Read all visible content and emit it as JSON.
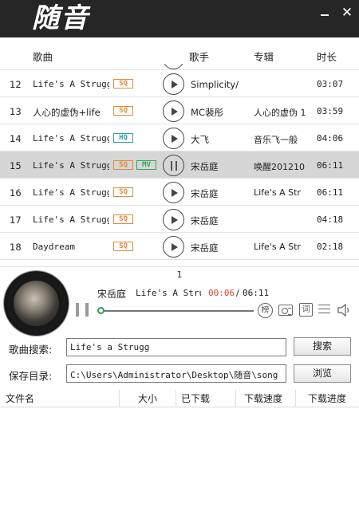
{
  "app": {
    "logo_text": "随音",
    "minimize_label": "",
    "close_label": "✕"
  },
  "song_list": {
    "headers": {
      "song": "歌曲",
      "singer": "歌手",
      "album": "专辑",
      "duration": "时长"
    },
    "rows": [
      {
        "num": "12",
        "title": "Life's A Strugg",
        "quality": "SQ",
        "mv": "",
        "singer": "Simplicity/",
        "album": "",
        "duration": "03:07"
      },
      {
        "num": "13",
        "title": "人心的虚伪+life",
        "quality": "SQ",
        "mv": "",
        "singer": "MC裴彤",
        "album": "人心的虚伪 1",
        "duration": "03:59"
      },
      {
        "num": "14",
        "title": "Life's A Strugg",
        "quality": "HQ",
        "mv": "",
        "singer": "大飞",
        "album": "音乐飞一般",
        "duration": "04:06"
      },
      {
        "num": "15",
        "title": "Life's A Strugg",
        "quality": "SQ",
        "mv": "MV",
        "singer": "宋岳庭",
        "album": "唤醒201210",
        "duration": "06:11"
      },
      {
        "num": "16",
        "title": "Life's A Strugg",
        "quality": "SQ",
        "mv": "",
        "singer": "宋岳庭",
        "album": "Life's A Str",
        "duration": "06:11"
      },
      {
        "num": "17",
        "title": "Life's A Strugg",
        "quality": "SQ",
        "mv": "",
        "singer": "宋岳庭",
        "album": "",
        "duration": "04:18"
      },
      {
        "num": "18",
        "title": "Daydream",
        "quality": "SQ",
        "mv": "",
        "singer": "宋岳庭",
        "album": "Life's A Str",
        "duration": "02:18"
      }
    ],
    "selected_index": 3,
    "page": "1"
  },
  "player": {
    "singer": "宋岳庭",
    "title": "Life's A Stru",
    "elapsed": "00:06",
    "separator": "/",
    "total": "06:11",
    "progress_fraction": 0.02,
    "chart_label": "榜",
    "lyric_label": "词"
  },
  "search": {
    "label": "歌曲搜索:",
    "value": "Life's a Strugg",
    "button": "搜索"
  },
  "save_dir": {
    "label": "保存目录:",
    "value": "C:\\Users\\Administrator\\Desktop\\随音\\song",
    "button": "浏览"
  },
  "downloads": {
    "headers": {
      "filename": "文件名",
      "size": "大小",
      "downloaded": "已下载",
      "speed": "下载速度",
      "progress": "下载进度"
    }
  },
  "colors": {
    "sq": "#e08a3a",
    "hq": "#2aa3a3",
    "mv": "#3aa35a",
    "elapsed": "#d4483b",
    "progress": "#2f9e5b",
    "titlebar": "#262626"
  }
}
